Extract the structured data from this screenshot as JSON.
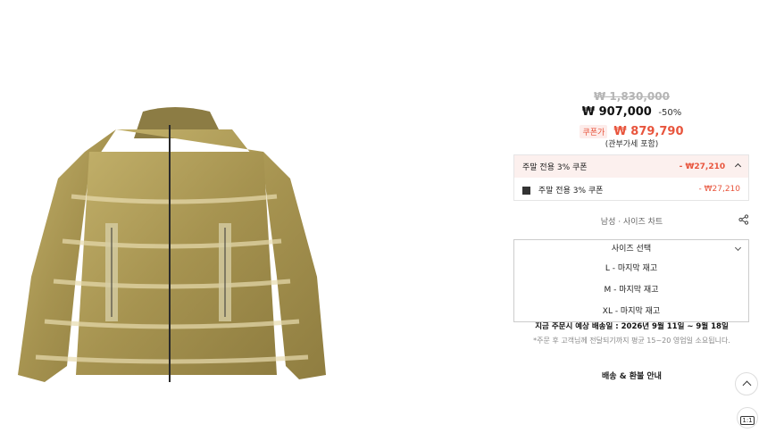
{
  "product": {
    "original_price": "₩ 1,830,000",
    "sale_price": "₩ 907,000",
    "discount": "-50%",
    "coupon_tag": "쿠폰가",
    "coupon_price": "₩ 879,790",
    "tax_note": "(관부가세 포함)"
  },
  "coupon_panel": {
    "header_label": "주말 전용 3% 쿠폰",
    "header_amount": "- ₩27,210",
    "item_label": "주말 전용 3% 쿠폰",
    "item_amount": "- ₩27,210"
  },
  "size_chart_link": "남성 · 사이즈 차트",
  "size_select": {
    "placeholder": "사이즈 선택",
    "options": [
      "L - 마지막 재고",
      "M - 마지막 재고",
      "XL - 마지막 재고"
    ]
  },
  "delivery": {
    "estimate": "지금 주문시 예상 배송일 : 2026년 9월 11일 ~ 9월 18일",
    "note": "*주문 후 고객님께 전달되기까지 평균 15~20 영업일 소요됩니다."
  },
  "shipping_link": "배송 & 환불 안내",
  "floating": {
    "ratio_label": "1:1"
  },
  "icons": [
    "chevron-up-icon",
    "share-icon",
    "chevron-down-icon",
    "scroll-top-icon"
  ],
  "colors": {
    "accent": "#e8553d",
    "coupon_bg": "#fcf0ee",
    "jacket": "#b4a05a"
  }
}
